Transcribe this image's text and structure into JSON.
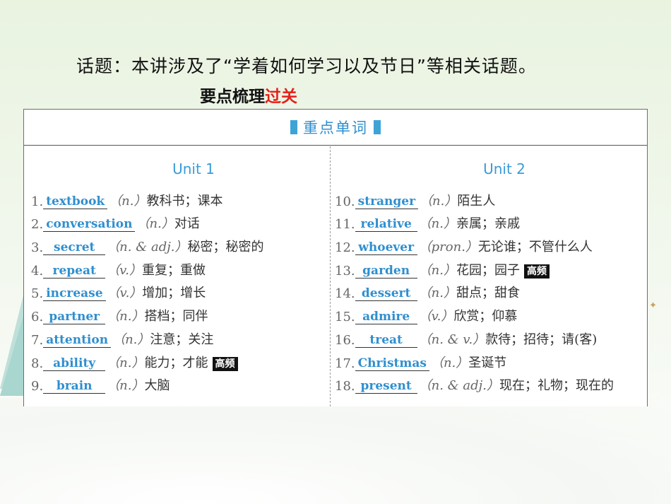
{
  "topic": "话题：本讲涉及了“学着如何学习以及节日”等相关话题。",
  "subtitle": {
    "main": "要点梳理",
    "highlight": "过关"
  },
  "card": {
    "header": "重点单词",
    "left": {
      "unit": "Unit 1",
      "rows": [
        {
          "num": "1.",
          "word": "textbook",
          "pos": "（n.）",
          "meaning": "教科书；课本",
          "tag": "",
          "w": 110
        },
        {
          "num": "2.",
          "word": "conversation",
          "pos": "（n.）",
          "meaning": "对话",
          "tag": "",
          "w": 140
        },
        {
          "num": "3.",
          "word": "secret",
          "pos": "（n. & adj.）",
          "meaning": "秘密；秘密的",
          "tag": "",
          "w": 84
        },
        {
          "num": "4.",
          "word": "repeat",
          "pos": "（v.）",
          "meaning": "重复；重做",
          "tag": "",
          "w": 88
        },
        {
          "num": "5.",
          "word": "increase",
          "pos": "（v.）",
          "meaning": "增加；增长",
          "tag": "",
          "w": 106
        },
        {
          "num": "6.",
          "word": "partner",
          "pos": "（n.）",
          "meaning": "搭档；同伴",
          "tag": "",
          "w": 106
        },
        {
          "num": "7.",
          "word": "attention",
          "pos": "（n.）",
          "meaning": "注意；关注",
          "tag": "",
          "w": 112
        },
        {
          "num": "8.",
          "word": "ability",
          "pos": "（n.）",
          "meaning": "能力；才能",
          "tag": "高频",
          "w": 92
        },
        {
          "num": "9.",
          "word": "brain",
          "pos": "（n.）",
          "meaning": "大脑",
          "tag": "",
          "w": 82
        }
      ]
    },
    "right": {
      "unit": "Unit 2",
      "rows": [
        {
          "num": "10.",
          "word": "stranger",
          "pos": "（n.）",
          "meaning": "陌生人",
          "tag": "",
          "w": 104
        },
        {
          "num": "11.",
          "word": "relative",
          "pos": "（n.）",
          "meaning": "亲属；亲戚",
          "tag": "",
          "w": 98
        },
        {
          "num": "12.",
          "word": "whoever",
          "pos": "（pron.）",
          "meaning": "无论谁；不管什么人",
          "tag": "",
          "w": 104
        },
        {
          "num": "13.",
          "word": "garden",
          "pos": "（n.）",
          "meaning": "花园；园子",
          "tag": "高频",
          "w": 92
        },
        {
          "num": "14.",
          "word": "dessert",
          "pos": "（n.）",
          "meaning": "甜点；甜食",
          "tag": "",
          "w": 92
        },
        {
          "num": "15.",
          "word": "admire",
          "pos": "（v.）",
          "meaning": "欣赏；仰慕",
          "tag": "",
          "w": 96
        },
        {
          "num": "16.",
          "word": "treat",
          "pos": "（n. & v.）",
          "meaning": "款待；招待；请(客)",
          "tag": "",
          "w": 76
        },
        {
          "num": "17.",
          "word": "Christmas",
          "pos": "（n.）",
          "meaning": "圣诞节",
          "tag": "",
          "w": 120
        },
        {
          "num": "18.",
          "word": "present",
          "pos": "（n. & adj.）",
          "meaning": "现在；礼物；现在的",
          "tag": "",
          "w": 96
        }
      ]
    }
  },
  "colors": {
    "accent": "#3a9bd6",
    "highlight": "#e6201a",
    "tag_bg": "#111111"
  }
}
